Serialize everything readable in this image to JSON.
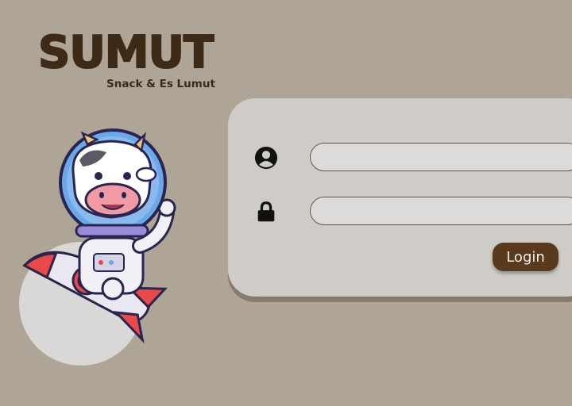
{
  "logo": {
    "title": "SUMUT",
    "subtitle": "Snack & Es Lumut"
  },
  "form": {
    "username_value": "",
    "password_value": "",
    "login_label": "Login"
  },
  "icons": {
    "username": "user-circle-icon",
    "password": "lock-icon"
  },
  "colors": {
    "background": "#aea597",
    "panel": "#cfccc7",
    "brand_brown": "#3d2a17",
    "button": "#5a3a1f"
  }
}
